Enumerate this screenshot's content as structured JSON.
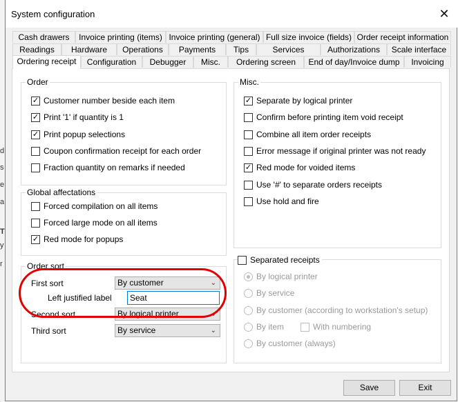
{
  "window": {
    "title": "System configuration",
    "close_glyph": "✕"
  },
  "tabs_row1": [
    "Cash drawers",
    "Invoice printing (items)",
    "Invoice printing (general)",
    "Full size invoice (fields)",
    "Order receipt information"
  ],
  "tabs_row2": [
    "Readings",
    "Hardware",
    "Operations",
    "Payments",
    "Tips",
    "Services",
    "Authorizations",
    "Scale interface"
  ],
  "tabs_row3": [
    "Ordering receipt",
    "Configuration",
    "Debugger",
    "Misc.",
    "Ordering screen",
    "End of day/Invoice dump",
    "Invoicing"
  ],
  "order": {
    "title": "Order",
    "items": [
      {
        "label": "Customer number beside each item",
        "checked": true
      },
      {
        "label": "Print '1' if quantity is 1",
        "checked": true
      },
      {
        "label": "Print popup selections",
        "checked": true
      },
      {
        "label": "Coupon confirmation receipt for each order",
        "checked": false
      },
      {
        "label": "Fraction quantity on remarks if needed",
        "checked": false
      }
    ]
  },
  "global": {
    "title": "Global affectations",
    "items": [
      {
        "label": "Forced compilation on all items",
        "checked": false
      },
      {
        "label": "Forced large mode on all items",
        "checked": false
      },
      {
        "label": "Red mode for popups",
        "checked": true
      }
    ]
  },
  "sort": {
    "title": "Order sort",
    "first_label": "First sort",
    "first_value": "By customer",
    "left_label": "Left justified label",
    "left_value": "Seat",
    "second_label": "Second sort",
    "second_value": "By logical printer",
    "third_label": "Third sort",
    "third_value": "By service"
  },
  "misc": {
    "title": "Misc.",
    "items": [
      {
        "label": "Separate by logical printer",
        "checked": true
      },
      {
        "label": "Confirm before printing item void receipt",
        "checked": false
      },
      {
        "label": "Combine all item order receipts",
        "checked": false
      },
      {
        "label": "Error message if original printer was not ready",
        "checked": false
      },
      {
        "label": "Red mode for voided items",
        "checked": true
      },
      {
        "label": "Use '#' to separate orders receipts",
        "checked": false
      },
      {
        "label": "Use hold and fire",
        "checked": false
      }
    ]
  },
  "separated": {
    "title": "Separated receipts",
    "checked": false,
    "options": [
      {
        "label": "By logical printer",
        "selected": true
      },
      {
        "label": "By service",
        "selected": false
      },
      {
        "label": "By customer (according to workstation's setup)",
        "selected": false
      },
      {
        "label": "By item",
        "selected": false
      },
      {
        "label": "By customer (always)",
        "selected": false
      }
    ],
    "with_numbering": "With numbering",
    "with_numbering_checked": false
  },
  "buttons": {
    "save": "Save",
    "exit": "Exit"
  },
  "icons": {
    "check": "✓",
    "chevron": "⌄"
  },
  "colors": {
    "highlight_ring": "#e00000",
    "input_focus": "#0078d7"
  }
}
